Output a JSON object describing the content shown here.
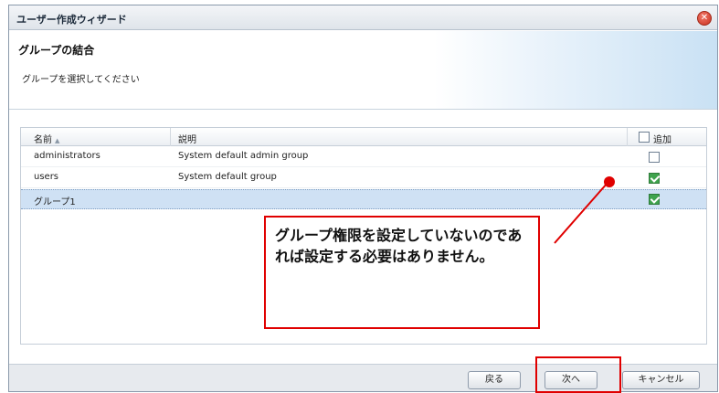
{
  "window": {
    "title": "ユーザー作成ウィザード"
  },
  "header": {
    "title": "グループの結合",
    "subtitle": "グループを選択してください"
  },
  "grid": {
    "columns": {
      "name": "名前",
      "description": "説明",
      "add": "追加"
    },
    "rows": [
      {
        "name": "administrators",
        "description": "System default admin group",
        "checked": false,
        "selected": false
      },
      {
        "name": "users",
        "description": "System default group",
        "checked": true,
        "selected": false
      },
      {
        "name": "グループ1",
        "description": "",
        "checked": true,
        "selected": true
      }
    ]
  },
  "buttons": {
    "back": "戻る",
    "next": "次へ",
    "cancel": "キャンセル"
  },
  "annotation": {
    "text": "グループ権限を設定していないのであれば設定する必要はありません。",
    "color": "#e00000"
  },
  "colors": {
    "selected_row": "#cfe1f4",
    "check_green": "#3fa34d",
    "close_red": "#c9301f"
  }
}
